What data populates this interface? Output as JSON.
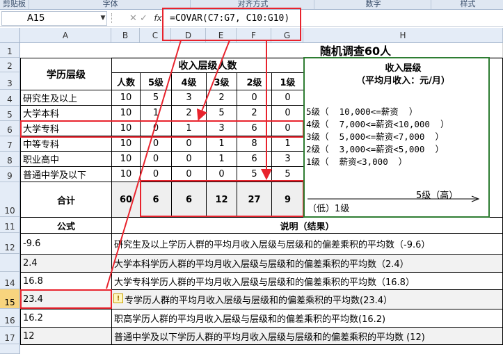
{
  "ribbon": {
    "tabs": [
      "剪贴板",
      "字体",
      "对齐方式",
      "数字",
      "样式"
    ]
  },
  "formula_bar": {
    "name_box": "A15",
    "fx": "fx",
    "formula": "=COVAR(C7:G7, C10:G10)"
  },
  "columns": [
    "A",
    "B",
    "C",
    "D",
    "E",
    "F",
    "G",
    "H"
  ],
  "rows": [
    "1",
    "2",
    "3",
    "4",
    "5",
    "6",
    "7",
    "8",
    "9",
    "10",
    "11",
    "12",
    "14",
    "15",
    "16",
    "17"
  ],
  "sheet": {
    "title": "随机调查60人",
    "edu_header": "学历层级",
    "income_header": "收入层级人数",
    "sub_headers": [
      "人数",
      "5级",
      "4级",
      "3级",
      "2级",
      "1级"
    ],
    "data_rows": [
      {
        "label": "研究生及以上",
        "values": [
          "10",
          "5",
          "3",
          "2",
          "0",
          "0"
        ]
      },
      {
        "label": "大学本科",
        "values": [
          "10",
          "1",
          "2",
          "5",
          "2",
          "0"
        ]
      },
      {
        "label": "大学专科",
        "values": [
          "10",
          "0",
          "1",
          "3",
          "6",
          "0"
        ]
      },
      {
        "label": "中等专科",
        "values": [
          "10",
          "0",
          "0",
          "1",
          "8",
          "1"
        ]
      },
      {
        "label": "职业高中",
        "values": [
          "10",
          "0",
          "0",
          "1",
          "6",
          "3"
        ]
      },
      {
        "label": "普通中学及以下",
        "values": [
          "10",
          "0",
          "0",
          "0",
          "5",
          "5"
        ]
      }
    ],
    "total_label": "合计",
    "totals": [
      "60",
      "6",
      "6",
      "12",
      "27",
      "9"
    ],
    "legend": {
      "title1": "收入层级",
      "title2": "（平均月收入：元/月）",
      "lines": [
        "5级（  10,000<=薪资  ）",
        "4级（  7,000<=薪资<10,000  ）",
        "3级（  5,000<=薪资<7,000  ）",
        "2级（  3,000<=薪资<5,000  ）",
        "1级（  薪资<3,000  ）"
      ],
      "high": "5级（高）",
      "low": "（低）1级"
    },
    "formula_header": "公式",
    "note_header": "说明（结果）",
    "results": [
      {
        "value": "-9.6",
        "note": "研究生及以上学历人群的平均月收入层级与层级和的偏差乘积的平均数（-9.6）"
      },
      {
        "value": "2.4",
        "note": "大学本科学历人群的平均月收入层级与层级和的偏差乘积的平均数（2.4）"
      },
      {
        "value": "16.8",
        "note": "大学专科学历人群的平均月收入层级与层级和的偏差乘积的平均数（16.8）"
      },
      {
        "value": "23.4",
        "note": "专学历人群的平均月收入层级与层级和的偏差乘积的平均数(23.4）"
      },
      {
        "value": "16.2",
        "note": "职高学历人群的平均月收入层级与层级和的偏差乘积的平均数(16.2)"
      },
      {
        "value": "12",
        "note": "普通中学及以下学历人群的平均月收入层级与层级和的偏差乘积的平均数 (12)"
      }
    ]
  },
  "colors": {
    "annotation_red": "#e8232d",
    "legend_green": "#2e7d32",
    "selected_row_header": "#f8d47e"
  }
}
